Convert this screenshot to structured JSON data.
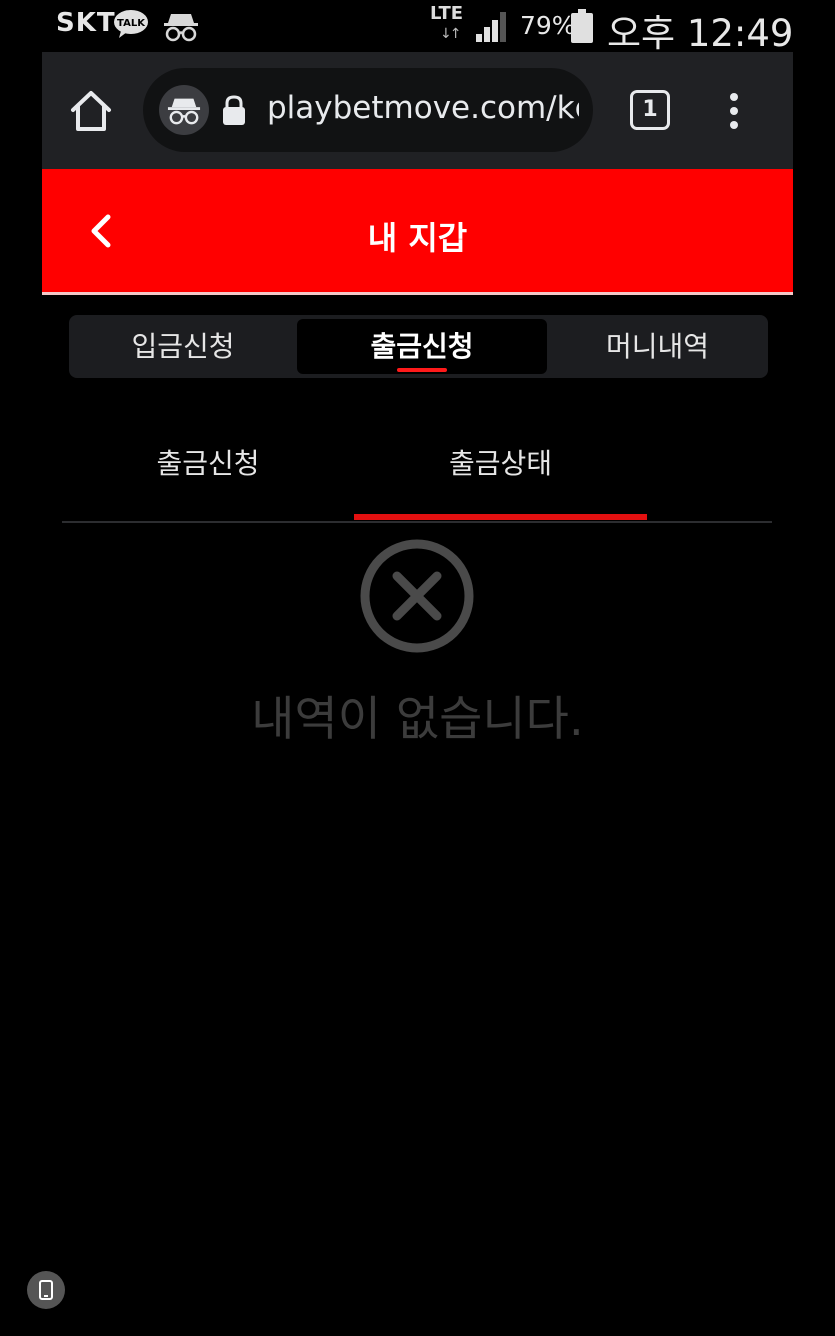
{
  "status_bar": {
    "carrier": "SKT",
    "talk_label": "TALK",
    "network": "LTE",
    "network_arrows": "↓↑",
    "battery": "79%",
    "time": "오후 12:49",
    "icons": [
      "kakaotalk-icon",
      "incognito-icon",
      "signal-icon",
      "battery-icon"
    ]
  },
  "browser": {
    "url": "playbetmove.com/kc",
    "tab_count": "1",
    "icons": [
      "home-icon",
      "incognito-icon",
      "lock-icon",
      "more-vert-icon"
    ]
  },
  "header": {
    "title": "내 지갑",
    "background": "#ff0000"
  },
  "main_tabs": [
    {
      "label": "입금신청",
      "active": false
    },
    {
      "label": "출금신청",
      "active": true
    },
    {
      "label": "머니내역",
      "active": false
    }
  ],
  "sub_tabs": [
    {
      "label": "출금신청",
      "active": false
    },
    {
      "label": "출금상태",
      "active": true
    }
  ],
  "empty_state": {
    "message": "내역이 없습니다.",
    "icon": "close-circle-icon"
  },
  "accent_color": "#e31010"
}
